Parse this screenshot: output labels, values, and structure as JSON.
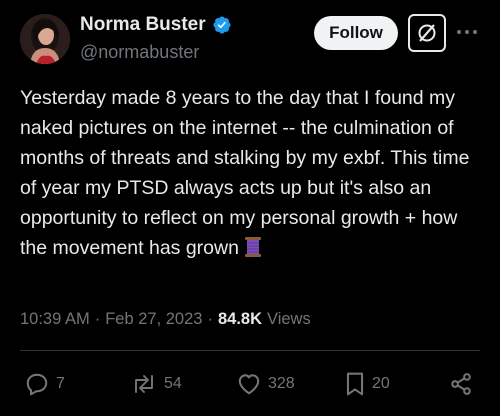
{
  "author": {
    "name": "Norma Buster",
    "handle": "@normabuster",
    "verified_color": "#1d9bf0"
  },
  "header": {
    "follow_label": "Follow",
    "grok_icon": "grok-icon",
    "more_icon": "more-dots-icon"
  },
  "tweet": {
    "text": "Yesterday made 8 years to the day that I found my naked pictures on the internet -- the culmination of months of threats and stalking by my exbf. This time of year my PTSD always acts up but it's also an opportunity to reflect on my personal growth + how the movement has grown",
    "emoji_icon": "thread-spool-icon"
  },
  "meta": {
    "time": "10:39 AM",
    "separator": "·",
    "date": "Feb 27, 2023",
    "separator2": "·",
    "views_count": "84.8K",
    "views_label": "Views"
  },
  "actions": {
    "replies": "7",
    "reposts": "54",
    "likes": "328",
    "bookmarks": "20"
  },
  "colors": {
    "background": "#000000",
    "text": "#e7e9ea",
    "secondary": "#71767b",
    "divider": "#2f3336"
  }
}
